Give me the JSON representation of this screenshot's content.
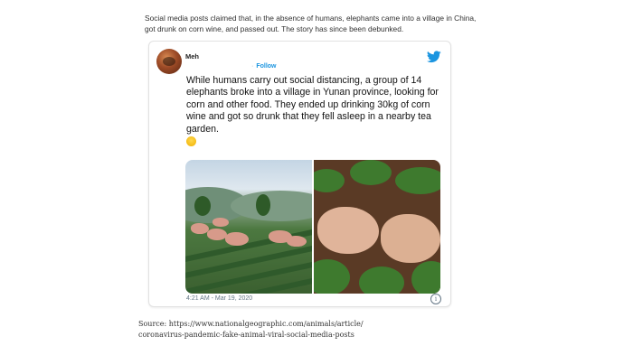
{
  "caption": {
    "line1": "Social media posts claimed that, in the absence of humans, elephants came into a village in China,",
    "line2": "got drunk on corn wine, and passed out. The story has since been debunked."
  },
  "tweet": {
    "username": "Meh",
    "follow_label": "Follow",
    "text": "While humans carry out social distancing, a group of 14 elephants broke into a village in Yunan province, looking for corn and other food. They ended up drinking 30kg of corn wine and got so drunk that they fell asleep in a nearby tea garden.",
    "timestamp": "4:21 AM - Mar 19, 2020",
    "info_glyph": "i",
    "icons": [
      "twitter-bird-icon",
      "laughing-emoji-icon",
      "info-icon"
    ],
    "brand_color": "#1b95e0"
  },
  "source": {
    "line1": "Source: https://www.nationalgeographic.com/animals/article/",
    "line2": "coronavirus-pandemic-fake-animal-viral-social-media-posts"
  }
}
